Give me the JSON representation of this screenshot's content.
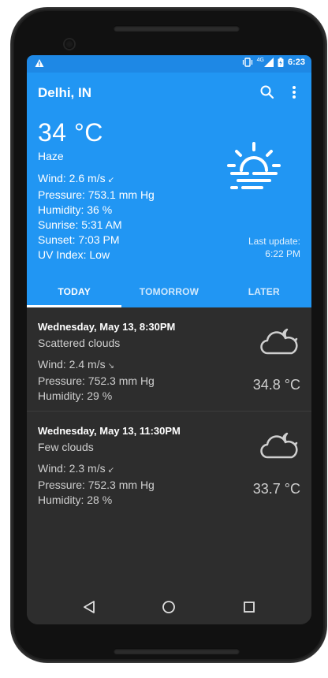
{
  "status_bar": {
    "warning_icon": "warning-icon",
    "network": "4G",
    "time": "6:23"
  },
  "app_bar": {
    "title": "Delhi, IN",
    "search_icon": "search-icon",
    "menu_icon": "more-vert-icon"
  },
  "current": {
    "temperature": "34 °C",
    "description": "Haze",
    "icon": "haze-icon",
    "wind": "Wind: 2.6 m/s",
    "wind_arrow": "↙",
    "pressure": "Pressure: 753.1 mm Hg",
    "humidity": "Humidity: 36 %",
    "sunrise": "Sunrise: 5:31 AM",
    "sunset": "Sunset: 7:03 PM",
    "uv_index": "UV Index: Low",
    "last_update_label": "Last update:",
    "last_update_time": "6:22 PM"
  },
  "tabs": [
    {
      "label": "TODAY",
      "active": true
    },
    {
      "label": "TOMORROW",
      "active": false
    },
    {
      "label": "LATER",
      "active": false
    }
  ],
  "forecast": [
    {
      "date": "Wednesday, May 13, 8:30PM",
      "description": "Scattered clouds",
      "wind": "Wind: 2.4 m/s",
      "wind_arrow": "↘",
      "pressure": "Pressure: 752.3 mm Hg",
      "humidity": "Humidity: 29 %",
      "temperature": "34.8 °C",
      "icon": "cloud-moon-icon"
    },
    {
      "date": "Wednesday, May 13, 11:30PM",
      "description": "Few clouds",
      "wind": "Wind: 2.3 m/s",
      "wind_arrow": "↙",
      "pressure": "Pressure: 752.3 mm Hg",
      "humidity": "Humidity: 28 %",
      "temperature": "33.7 °C",
      "icon": "cloud-moon-icon"
    }
  ],
  "nav": {
    "back_icon": "back-triangle-icon",
    "home_icon": "home-circle-icon",
    "recents_icon": "recents-square-icon"
  },
  "colors": {
    "primary": "#2196f3",
    "status_bar": "#1e88e5",
    "background": "#2d2d2d"
  }
}
